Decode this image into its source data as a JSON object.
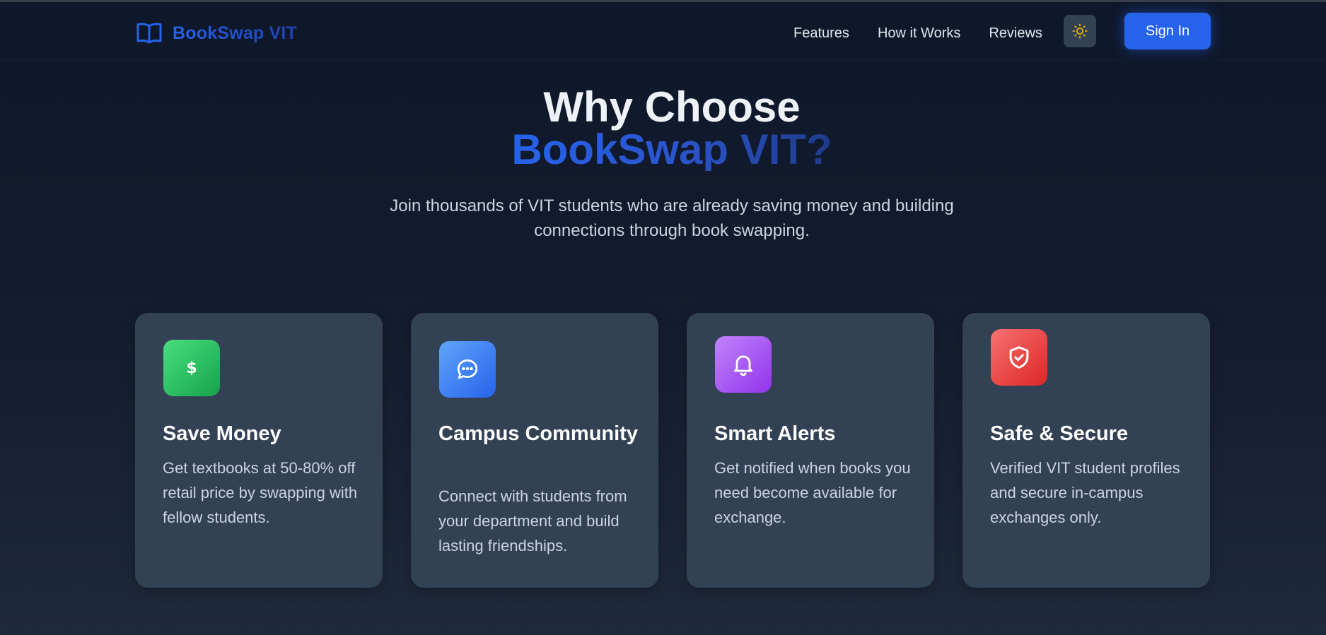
{
  "header": {
    "brand_name": "BookSwap VIT",
    "brand_icon": "open-book-icon",
    "nav": [
      {
        "label": "Features"
      },
      {
        "label": "How it Works"
      },
      {
        "label": "Reviews"
      }
    ],
    "theme_toggle_icon": "sun-icon",
    "signin_label": "Sign In"
  },
  "hero": {
    "title_line1": "Why Choose",
    "title_line2": "BookSwap VIT?",
    "subtitle": "Join thousands of VIT students who are already saving money and building connections through book swapping."
  },
  "features": [
    {
      "icon": "dollar-icon",
      "title": "Save Money",
      "description": "Get textbooks at 50-80% off retail price by swapping with fellow students.",
      "gradient": [
        "#4ade80",
        "#16a34a"
      ]
    },
    {
      "icon": "chat-bubble-icon",
      "title": "Campus Community",
      "description": "Connect with students from your department and build lasting friendships.",
      "gradient": [
        "#60a5fa",
        "#2563eb"
      ]
    },
    {
      "icon": "bell-icon",
      "title": "Smart Alerts",
      "description": "Get notified when books you need become available for exchange.",
      "gradient": [
        "#c084fc",
        "#9333ea"
      ]
    },
    {
      "icon": "shield-check-icon",
      "title": "Safe & Secure",
      "description": "Verified VIT student profiles and secure in-campus exchanges only.",
      "gradient": [
        "#f87171",
        "#dc2626"
      ]
    }
  ],
  "colors": {
    "accent": "#2563eb",
    "background": "#0f172a",
    "card": "#334155",
    "sun": "#eab308"
  }
}
